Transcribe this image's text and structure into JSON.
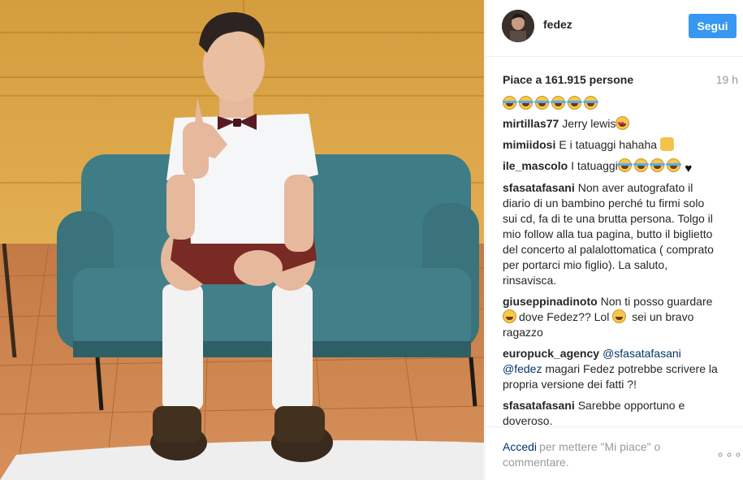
{
  "header": {
    "username": "fedez",
    "follow_label": "Segui"
  },
  "post": {
    "likes_text": "Piace a 161.915 persone",
    "time": "19 h"
  },
  "comments": [
    {
      "user": "mirtillas77",
      "text": "Jerry lewis"
    },
    {
      "user": "mimiidosi",
      "text": "E i tatuaggi hahaha"
    },
    {
      "user": "ile_mascolo",
      "text": "I tatuaggi"
    },
    {
      "user": "sfasatafasani",
      "text": "Non aver autografato il diario di un bambino perché tu firmi solo sui cd, fa di te una brutta persona. Tolgo il mio follow alla tua pagina, butto il biglietto del concerto al palalottomatica ( comprato per portarci mio figlio). La saluto, rinsavisca."
    },
    {
      "user": "giuseppinadinoto",
      "text_a": "Non ti posso guardare",
      "text_b": "dove Fedez?? Lol",
      "text_c": "sei un bravo ragazzo"
    },
    {
      "user": "europuck_agency",
      "mention1": "@sfasatafasani",
      "mention2": "@fedez",
      "text": "magari Fedez potrebbe scrivere la propria versione dei fatti ?!"
    },
    {
      "user": "sfasatafasani",
      "text": "Sarebbe opportuno e doveroso."
    }
  ],
  "footer": {
    "login_link": "Accedi",
    "login_text": "per mettere \"Mi piace\" o commentare.",
    "more_label": "∘∘∘"
  },
  "colors": {
    "accent": "#3897f0",
    "link": "#003569",
    "muted": "#999999"
  }
}
